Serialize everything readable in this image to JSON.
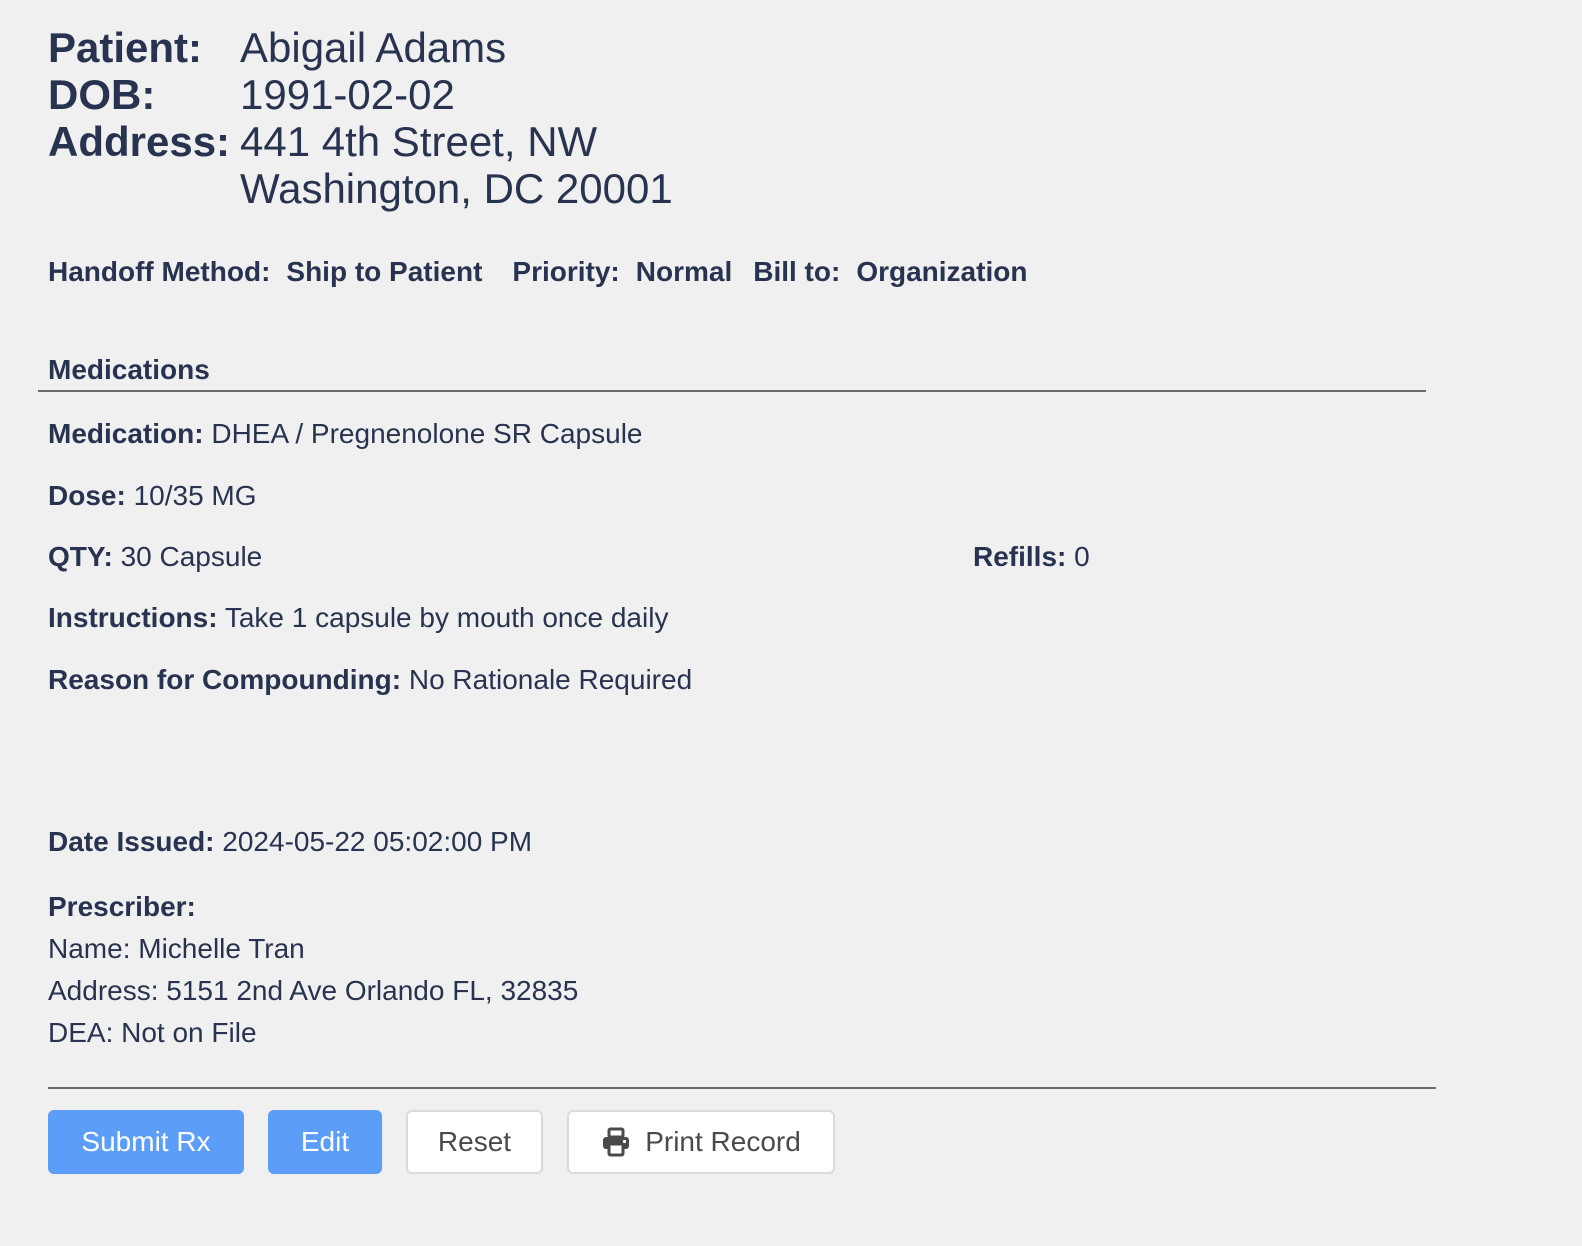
{
  "patient": {
    "patient_label": "Patient:",
    "patient_name": "Abigail Adams",
    "dob_label": "DOB:",
    "dob": "1991-02-02",
    "address_label": "Address:",
    "address_line1": "441 4th Street, NW",
    "address_line2": "Washington, DC 20001"
  },
  "order": {
    "handoff_label": "Handoff Method:",
    "handoff_value": "Ship to Patient",
    "priority_label": "Priority:",
    "priority_value": "Normal",
    "bill_label": "Bill to:",
    "bill_value": "Organization"
  },
  "medications": {
    "section_title": "Medications",
    "medication_label": "Medication:",
    "medication_value": "DHEA / Pregnenolone SR Capsule",
    "dose_label": "Dose:",
    "dose_value": "10/35 MG",
    "qty_label": "QTY:",
    "qty_value": "30 Capsule",
    "refills_label": "Refills:",
    "refills_value": "0",
    "instructions_label": "Instructions:",
    "instructions_value": "Take 1 capsule by mouth once daily",
    "reason_label": "Reason for Compounding:",
    "reason_value": "No Rationale Required"
  },
  "issued": {
    "label": "Date Issued:",
    "value": "2024-05-22 05:02:00 PM"
  },
  "prescriber": {
    "title": "Prescriber:",
    "name_line": "Name: Michelle Tran",
    "address_line": "Address: 5151 2nd Ave Orlando FL, 32835",
    "dea_line": "DEA: Not on File"
  },
  "actions": {
    "submit_label": "Submit Rx",
    "edit_label": "Edit",
    "reset_label": "Reset",
    "print_label": "Print Record",
    "print_icon": "printer-icon"
  },
  "colors": {
    "text": "#283350",
    "primary_button": "#5b9df7",
    "background": "#f0f0f0"
  }
}
